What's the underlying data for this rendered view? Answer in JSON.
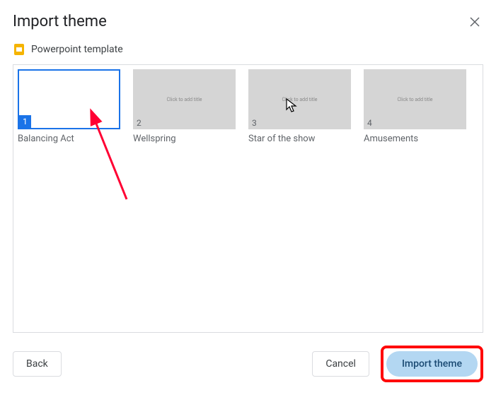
{
  "dialog": {
    "title": "Import theme",
    "close_label": "Close"
  },
  "source": {
    "icon": "slides-icon",
    "filename": "Powerpoint template"
  },
  "themes": [
    {
      "number": "1",
      "name": "Balancing Act",
      "thumb_text": "",
      "selected": true
    },
    {
      "number": "2",
      "name": "Wellspring",
      "thumb_text": "Click to add title",
      "selected": false
    },
    {
      "number": "3",
      "name": "Star of the show",
      "thumb_text": "Click to add title",
      "selected": false
    },
    {
      "number": "4",
      "name": "Amusements",
      "thumb_text": "Click to add title",
      "selected": false
    }
  ],
  "buttons": {
    "back": "Back",
    "cancel": "Cancel",
    "import": "Import theme"
  },
  "annotations": {
    "arrow_target": "theme-item-1",
    "highlight_target": "import-button"
  }
}
